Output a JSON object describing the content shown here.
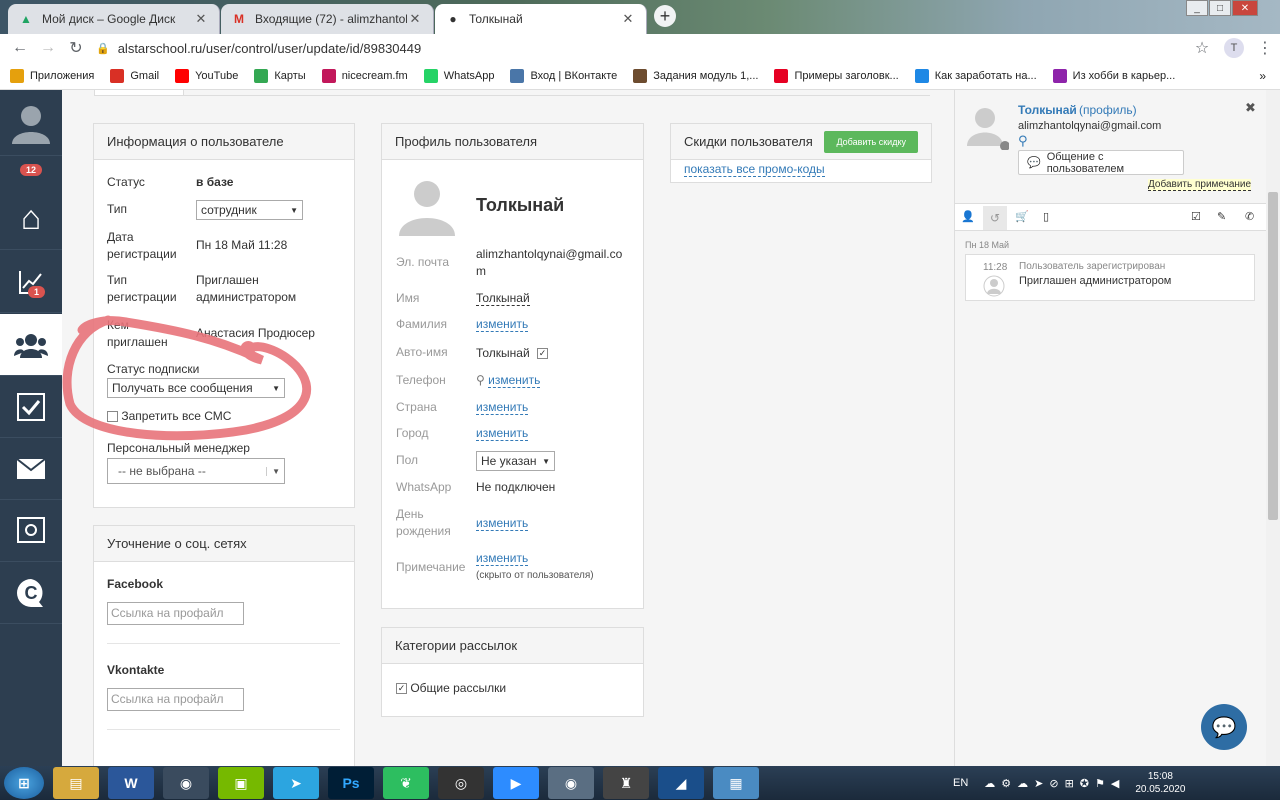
{
  "browser": {
    "tabs": [
      {
        "title": "Мой диск – Google Диск",
        "icon": "drive-icon"
      },
      {
        "title": "Входящие (72) - alimzhantolqynai",
        "icon": "gmail-icon"
      },
      {
        "title": "Толкынай",
        "icon": "location-pin-icon"
      }
    ],
    "url": "alstarschool.ru/user/control/user/update/id/89830449",
    "profile_initial": "T",
    "bookmarks": [
      {
        "label": "Приложения",
        "icon": "apps-icon",
        "color": "#e5a00d"
      },
      {
        "label": "Gmail",
        "icon": "gmail-icon",
        "color": "#d93025"
      },
      {
        "label": "YouTube",
        "icon": "youtube-icon",
        "color": "#ff0000"
      },
      {
        "label": "Карты",
        "icon": "maps-icon",
        "color": "#34a853"
      },
      {
        "label": "nicecream.fm",
        "icon": "nicecream-icon",
        "color": "#c2185b"
      },
      {
        "label": "WhatsApp",
        "icon": "whatsapp-icon",
        "color": "#25d366"
      },
      {
        "label": "Вход | ВКонтакте",
        "icon": "vk-icon",
        "color": "#4a76a8"
      },
      {
        "label": "Задания модуль 1,...",
        "icon": "bookmark-page-icon",
        "color": "#6d4c2f"
      },
      {
        "label": "Примеры заголовк...",
        "icon": "pinterest-icon",
        "color": "#e60023"
      },
      {
        "label": "Как заработать на...",
        "icon": "k-icon",
        "color": "#1e88e5"
      },
      {
        "label": "Из хобби в карьер...",
        "icon": "l-icon",
        "color": "#8e24aa"
      }
    ]
  },
  "sidebar": {
    "notifications_badge": "12",
    "chart_badge": "1"
  },
  "user_info": {
    "header": "Информация о пользователе",
    "status_label": "Статус",
    "status_value": "в базе",
    "type_label": "Тип",
    "type_value": "сотрудник",
    "reg_date_label": "Дата регистрации",
    "reg_date_value": "Пн 18 Май 11:28",
    "reg_type_label": "Тип регистрации",
    "reg_type_value": "Приглашен администратором",
    "invited_by_label": "Кем приглашен",
    "invited_by_value": "Анастасия Продюсер",
    "subscription_label": "Статус подписки",
    "subscription_value": "Получать все сообщения",
    "no_sms_label": "Запретить все СМС",
    "manager_label": "Персональный менеджер",
    "manager_value": "-- не выбрана --"
  },
  "social": {
    "header": "Уточнение о соц. сетях",
    "facebook_label": "Facebook",
    "facebook_placeholder": "Ссылка на профайл",
    "vk_label": "Vkontakte",
    "vk_placeholder": "Ссылка на профайл"
  },
  "profile": {
    "header": "Профиль пользователя",
    "name": "Толкынай",
    "email_label": "Эл. почта",
    "email_value": "alimzhantolqynai@gmail.com",
    "first_name_label": "Имя",
    "first_name_value": "Толкынай",
    "last_name_label": "Фамилия",
    "change": "изменить",
    "auto_name_label": "Авто-имя",
    "auto_name_value": "Толкынай",
    "phone_label": "Телефон",
    "country_label": "Страна",
    "city_label": "Город",
    "gender_label": "Пол",
    "gender_value": "Не указан",
    "whatsapp_label": "WhatsApp",
    "whatsapp_value": "Не подключен",
    "birthday_label": "День рождения",
    "note_label": "Примечание",
    "note_hint": "(скрыто от пользователя)"
  },
  "mailing": {
    "header": "Категории рассылок",
    "general": "Общие рассылки"
  },
  "discounts": {
    "header": "Скидки пользователя",
    "add_button": "Добавить скидку",
    "show_promo": "показать все промо-коды"
  },
  "right_panel": {
    "name": "Толкынай",
    "profile_link": "(профиль)",
    "email": "alimzhantolqynai@gmail.com",
    "chat_button": "Общение с пользователем",
    "add_note": "Добавить примечание",
    "date": "Пн 18 Май",
    "event_time": "11:28",
    "event_title": "Пользователь зарегистрирован",
    "event_desc": "Приглашен администратором"
  },
  "taskbar": {
    "lang": "EN",
    "time": "15:08",
    "date": "20.05.2020"
  },
  "colors": {
    "sidebar": "#2d3e50",
    "accent": "#337ab7",
    "green_button": "#5cb85c",
    "annotation": "#e8737a"
  }
}
